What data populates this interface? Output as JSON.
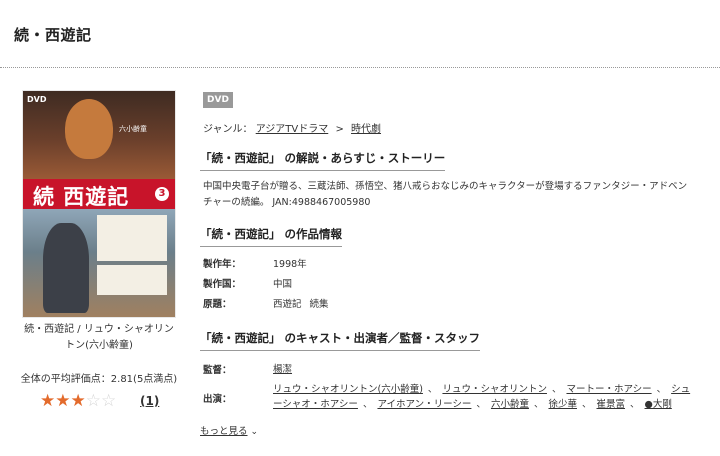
{
  "page_title": "続・西遊記",
  "cover": {
    "dvd_mark": "DVD",
    "title_logo": "続 西遊記",
    "volume": "3",
    "cast_text": "六小齢童"
  },
  "cover_caption": "続・西遊記 / リュウ・シャオリントン(六小齢童)",
  "rating": {
    "label": "全体の平均評価点：2.81(5点満点)",
    "value": 2.81,
    "max": 5,
    "stars_filled": 3,
    "review_count": "(1)"
  },
  "badge": "DVD",
  "genre": {
    "label": "ジャンル：",
    "items": [
      "アジアTVドラマ",
      "時代劇"
    ],
    "separator": ">"
  },
  "synopsis": {
    "heading": "「続・西遊記」 の解説・あらすじ・ストーリー",
    "line1": "中国中央電子台が贈る、三蔵法師、孫悟空、猪八戒らおなじみのキャラクターが登場するファンタジー・アドベン",
    "line2": "チャーの続編。 JAN:4988467005980"
  },
  "work_info": {
    "heading": "「続・西遊記」 の作品情報",
    "rows": [
      {
        "label": "製作年：",
        "value": "1998年"
      },
      {
        "label": "製作国：",
        "value": "中国"
      },
      {
        "label": "原題：",
        "value": "西遊記",
        "value2": "続集"
      }
    ]
  },
  "cast_section": {
    "heading": "「続・西遊記」 のキャスト・出演者／監督・スタッフ",
    "director_label": "監督：",
    "director": "楊潔",
    "cast_label": "出演：",
    "cast": [
      "リュウ・シャオリントン(六小齢童)",
      "リュウ・シャオリントン",
      "マートー・ホアシー",
      "シューシャオ・ホアシー",
      "アイホアン・リーシー",
      "六小齢童",
      "徐少華",
      "崔景富",
      "●大剛"
    ],
    "more_label": "もっと見る"
  }
}
